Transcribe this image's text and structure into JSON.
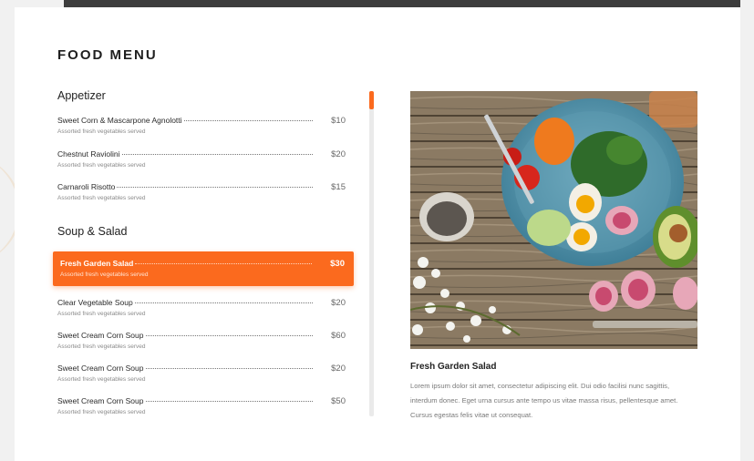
{
  "menu": {
    "title": "FOOD MENU",
    "sections": [
      {
        "title": "Appetizer",
        "items": [
          {
            "name": "Sweet Corn & Mascarpone Agnolotti",
            "price": "$10",
            "desc": "Assorted fresh vegetables served"
          },
          {
            "name": "Chestnut Raviolini",
            "price": "$20",
            "desc": "Assorted fresh vegetables served"
          },
          {
            "name": "Carnaroli Risotto",
            "price": "$15",
            "desc": "Assorted fresh vegetables served"
          }
        ]
      },
      {
        "title": "Soup & Salad",
        "items": [
          {
            "name": "Fresh Garden Salad",
            "price": "$30",
            "desc": "Assorted fresh vegetables served",
            "active": true
          },
          {
            "name": "Clear Vegetable Soup",
            "price": "$20",
            "desc": "Assorted fresh vegetables served"
          },
          {
            "name": "Sweet Cream Corn Soup",
            "price": "$60",
            "desc": "Assorted fresh vegetables served"
          },
          {
            "name": "Sweet Cream Corn Soup",
            "price": "$20",
            "desc": "Assorted fresh vegetables served"
          },
          {
            "name": "Sweet Cream Corn Soup",
            "price": "$50",
            "desc": "Assorted fresh vegetables served"
          }
        ]
      }
    ]
  },
  "feature": {
    "title": "Fresh Garden Salad",
    "description": "Lorem ipsum dolor sit amet, consectetur adipiscing elit. Dui odio facilisi nunc sagittis, interdum donec. Eget urna cursus ante tempo us vitae massa risus, pellentesque amet. Cursus egestas felis vitae ut consequat.",
    "image_icon": "salad-photo"
  },
  "colors": {
    "accent": "#fb6a1e",
    "background": "#ffffff",
    "page": "#f1f1f1"
  }
}
